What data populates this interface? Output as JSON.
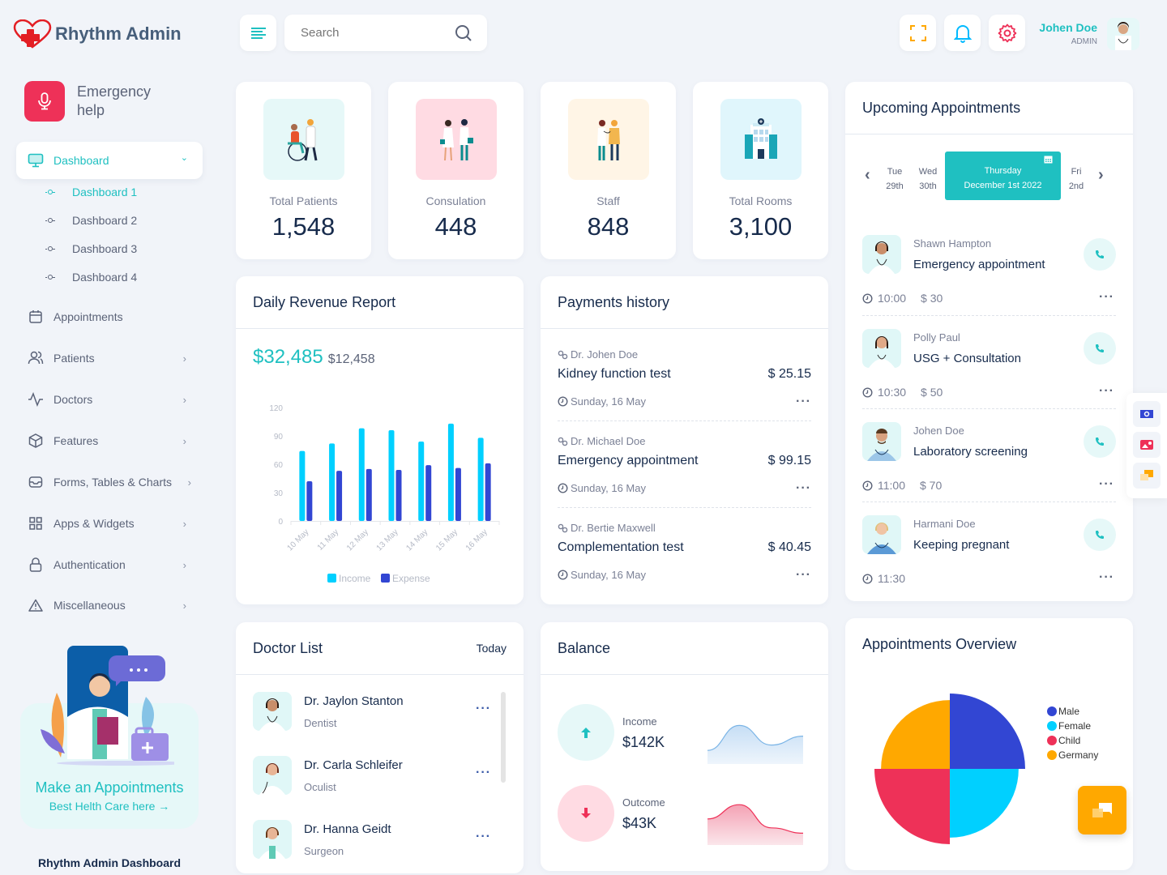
{
  "app": {
    "brand": "Rhythm Admin",
    "footer_title": "Rhythm Admin Dashboard"
  },
  "header": {
    "search_placeholder": "Search",
    "user_name": "Johen Doe",
    "user_role": "ADMIN",
    "icons": [
      "menu-icon",
      "search-icon",
      "fullscreen-icon",
      "bell-icon",
      "gear-icon"
    ]
  },
  "sidebar": {
    "emergency_label_line1": "Emergency",
    "emergency_label_line2": "help",
    "active": {
      "label": "Dashboard",
      "icon": "monitor-icon"
    },
    "sub_items": [
      "Dashboard 1",
      "Dashboard 2",
      "Dashboard 3",
      "Dashboard 4"
    ],
    "items": [
      {
        "label": "Appointments",
        "icon": "calendar-icon",
        "has_children": false
      },
      {
        "label": "Patients",
        "icon": "users-icon",
        "has_children": true
      },
      {
        "label": "Doctors",
        "icon": "activity-icon",
        "has_children": true
      },
      {
        "label": "Features",
        "icon": "box-icon",
        "has_children": true
      },
      {
        "label": "Forms, Tables & Charts",
        "icon": "inbox-icon",
        "has_children": true
      },
      {
        "label": "Apps & Widgets",
        "icon": "grid-icon",
        "has_children": true
      },
      {
        "label": "Authentication",
        "icon": "lock-icon",
        "has_children": true
      },
      {
        "label": "Miscellaneous",
        "icon": "alert-icon",
        "has_children": true
      }
    ],
    "promo": {
      "title": "Make an Appointments",
      "link": "Best Helth Care here →"
    }
  },
  "stats": [
    {
      "label": "Total Patients",
      "value": "1,548",
      "bg": "#e6f8f8"
    },
    {
      "label": "Consulation",
      "value": "448",
      "bg": "#ffdbe3"
    },
    {
      "label": "Staff",
      "value": "848",
      "bg": "#fff5e6"
    },
    {
      "label": "Total Rooms",
      "value": "3,100",
      "bg": "#e0f6fc"
    }
  ],
  "revenue": {
    "title": "Daily Revenue Report",
    "primary_value": "$32,485",
    "secondary_value": "$12,458"
  },
  "payments": {
    "title": "Payments history",
    "items": [
      {
        "doctor": "Dr. Johen Doe",
        "test": "Kidney function test",
        "amount": "$ 25.15",
        "date": "Sunday, 16 May"
      },
      {
        "doctor": "Dr. Michael Doe",
        "test": "Emergency appointment",
        "amount": "$ 99.15",
        "date": "Sunday, 16 May"
      },
      {
        "doctor": "Dr. Bertie Maxwell",
        "test": "Complementation test",
        "amount": "$ 40.45",
        "date": "Sunday, 16 May"
      }
    ]
  },
  "upcoming": {
    "title": "Upcoming Appointments",
    "days": [
      {
        "day": "Tue",
        "date": "29th"
      },
      {
        "day": "Wed",
        "date": "30th"
      }
    ],
    "selected": {
      "day": "Thursday",
      "date": "December 1st 2022"
    },
    "next_day": {
      "day": "Fri",
      "date": "2nd"
    },
    "items": [
      {
        "name": "Shawn Hampton",
        "reason": "Emergency appointment",
        "time": "10:00",
        "price": "$ 30"
      },
      {
        "name": "Polly Paul",
        "reason": "USG + Consultation",
        "time": "10:30",
        "price": "$ 50"
      },
      {
        "name": "Johen Doe",
        "reason": "Laboratory screening",
        "time": "11:00",
        "price": "$ 70"
      },
      {
        "name": "Harmani Doe",
        "reason": "Keeping pregnant",
        "time": "11:30",
        "price": ""
      }
    ]
  },
  "doctors": {
    "title": "Doctor List",
    "filter": "Today",
    "items": [
      {
        "name": "Dr. Jaylon Stanton",
        "specialty": "Dentist"
      },
      {
        "name": "Dr. Carla Schleifer",
        "specialty": "Oculist"
      },
      {
        "name": "Dr. Hanna Geidt",
        "specialty": "Surgeon"
      }
    ]
  },
  "balance": {
    "title": "Balance",
    "income": {
      "label": "Income",
      "value": "$142K",
      "trend": [
        0.2,
        0.9,
        0.35,
        0.6
      ]
    },
    "outcome": {
      "label": "Outcome",
      "value": "$43K",
      "trend": [
        0.55,
        0.95,
        0.3,
        0.15
      ]
    }
  },
  "overview": {
    "title": "Appointments Overview"
  },
  "colors": {
    "accent": "#1fc0c1",
    "income": "#00d0ff",
    "expense": "#3246d3",
    "danger": "#ee3158",
    "warning": "#ffa800"
  },
  "chart_data": [
    {
      "type": "bar",
      "title": "Daily Revenue Report",
      "categories": [
        "10 May",
        "11 May",
        "12 May",
        "13 May",
        "14 May",
        "15 May",
        "16 May"
      ],
      "series": [
        {
          "name": "Income",
          "color": "#00d0ff",
          "values": [
            74,
            82,
            98,
            96,
            84,
            103,
            88
          ]
        },
        {
          "name": "Expense",
          "color": "#3246d3",
          "values": [
            42,
            53,
            55,
            54,
            59,
            56,
            61
          ]
        }
      ],
      "yticks": [
        0,
        30,
        60,
        90,
        120
      ],
      "ylim": [
        0,
        120
      ],
      "legend": "bottom",
      "grid": false
    },
    {
      "type": "pie",
      "subtype": "polar-area",
      "title": "Appointments Overview",
      "categories": [
        "Male",
        "Female",
        "Child",
        "Germany"
      ],
      "values": [
        12,
        10,
        12,
        10
      ],
      "colors": [
        "#3246d3",
        "#00d0ff",
        "#ee3158",
        "#ffa800"
      ],
      "legend": "right"
    }
  ]
}
